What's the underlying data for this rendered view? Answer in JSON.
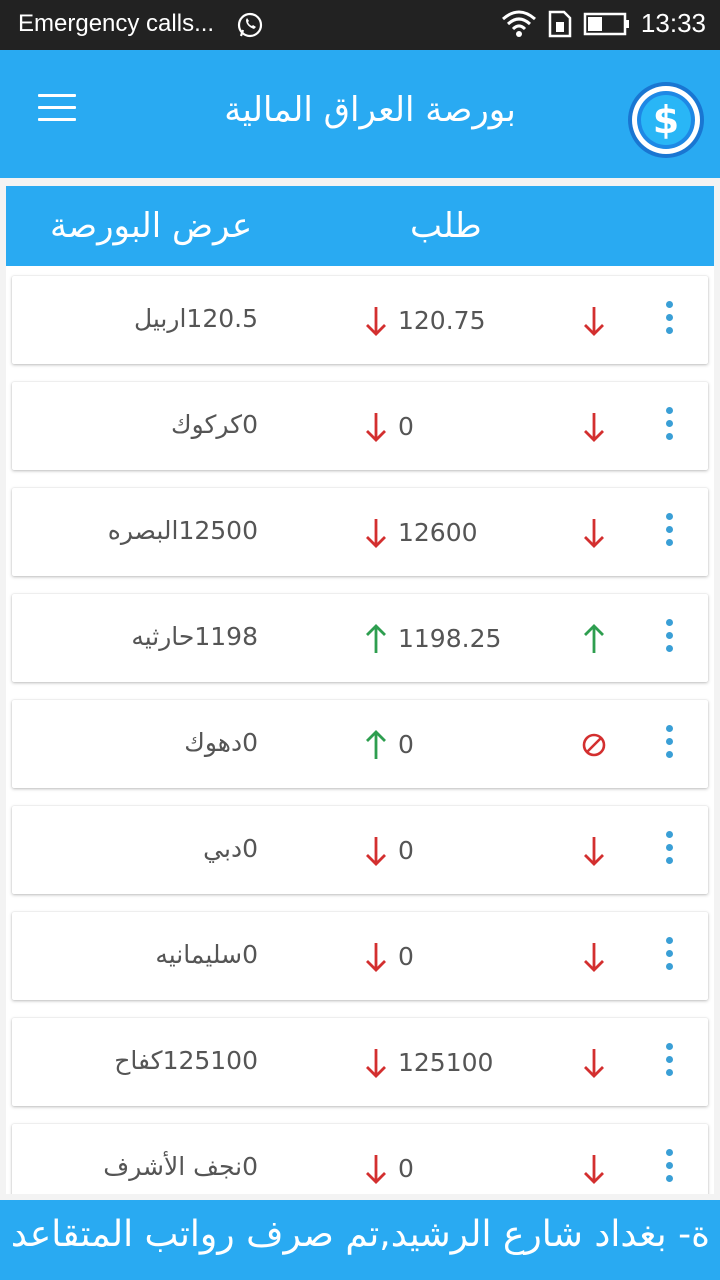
{
  "status_bar": {
    "carrier_text": "Emergency calls...",
    "time": "13:33",
    "icons": [
      "whatsapp-icon",
      "wifi-icon",
      "sim-icon",
      "battery-icon"
    ]
  },
  "app_bar": {
    "title": "بورصة العراق المالية",
    "menu_icon": "hamburger-menu-icon",
    "logo_icon": "dollar-coin-icon"
  },
  "table": {
    "col_offer": "عرض البورصة",
    "col_bid": "طلب"
  },
  "colors": {
    "accent": "#29aaf2",
    "down": "#d32f2f",
    "up": "#2e9e4f",
    "dots": "#3a9fd6"
  },
  "rows": [
    {
      "city": "120.5اربيل",
      "bid_arrow": "down",
      "bid": "120.75",
      "trend": "down"
    },
    {
      "city": "0كركوك",
      "bid_arrow": "down",
      "bid": "0",
      "trend": "down"
    },
    {
      "city": "12500البصره",
      "bid_arrow": "down",
      "bid": "12600",
      "trend": "down"
    },
    {
      "city": "1198حارثيه",
      "bid_arrow": "up",
      "bid": "1198.25",
      "trend": "up"
    },
    {
      "city": "0دهوك",
      "bid_arrow": "up",
      "bid": "0",
      "trend": "none"
    },
    {
      "city": "0دبي",
      "bid_arrow": "down",
      "bid": "0",
      "trend": "down"
    },
    {
      "city": "0سليمانيه",
      "bid_arrow": "down",
      "bid": "0",
      "trend": "down"
    },
    {
      "city": "125100كفاح",
      "bid_arrow": "down",
      "bid": "125100",
      "trend": "down"
    },
    {
      "city": "0نجف الأشرف",
      "bid_arrow": "down",
      "bid": "0",
      "trend": "down"
    }
  ],
  "ticker": {
    "text": "ة- بغداد شارع الرشيد,تم صرف رواتب المتقاعد"
  }
}
